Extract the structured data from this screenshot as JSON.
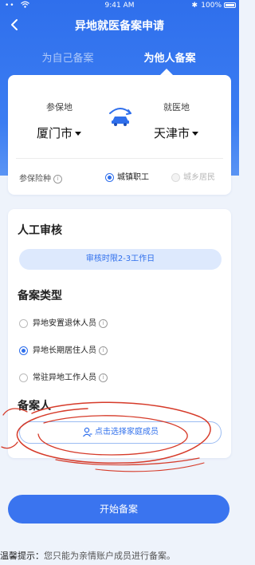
{
  "status_bar": {
    "time": "9:41 AM",
    "battery": "100%",
    "signal": "••",
    "bluetooth": "✱"
  },
  "nav": {
    "title": "异地就医备案申请",
    "back_icon": "chevron-left-icon"
  },
  "tabs": {
    "self": "为自己备案",
    "others": "为他人备案",
    "active": "others"
  },
  "location": {
    "insured_label": "参保地",
    "insured_value": "厦门市",
    "medical_label": "就医地",
    "medical_value": "天津市",
    "insurance_type_label": "参保险种",
    "options": [
      {
        "label": "城镇职工",
        "checked": true,
        "disabled": false
      },
      {
        "label": "城乡居民",
        "checked": false,
        "disabled": true
      }
    ]
  },
  "manual_review": {
    "title": "人工审核",
    "pill": "审核时限2-3工作日"
  },
  "filing_type": {
    "title": "备案类型",
    "options": [
      {
        "label": "异地安置退休人员",
        "checked": false
      },
      {
        "label": "异地长期居住人员",
        "checked": true
      },
      {
        "label": "常驻异地工作人员",
        "checked": false
      }
    ]
  },
  "filer": {
    "title": "备案人",
    "select_button": "点击选择家庭成员"
  },
  "actions": {
    "start_button": "开始备案"
  },
  "tip": {
    "label": "温馨提示：",
    "text": "您只能为亲情账户成员进行备案。"
  },
  "colors": {
    "primary": "#2f6fec",
    "pill_bg": "#dde9fd",
    "page_bg": "#eef3fb",
    "annotation": "#d63b2a"
  }
}
